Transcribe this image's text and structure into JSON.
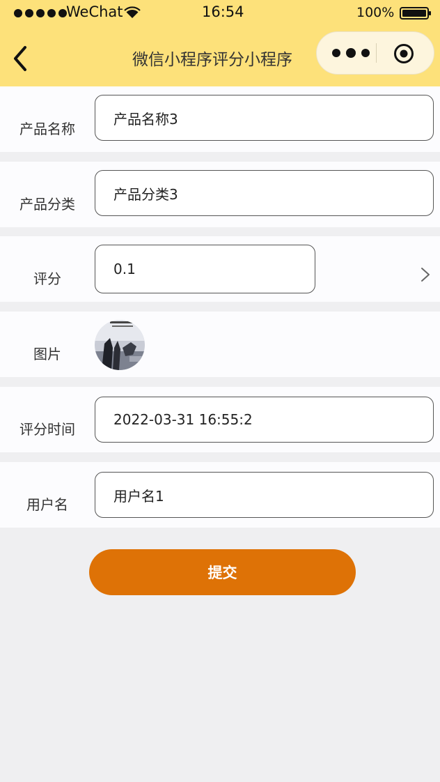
{
  "status_bar": {
    "carrier": "WeChat",
    "time": "16:54",
    "battery": "100%"
  },
  "nav": {
    "title": "微信小程序评分小程序"
  },
  "form": {
    "product_name": {
      "label": "产品名称",
      "value": "产品名称3"
    },
    "product_category": {
      "label": "产品分类",
      "value": "产品分类3"
    },
    "score": {
      "label": "评分",
      "value": "0.1"
    },
    "image": {
      "label": "图片"
    },
    "score_time": {
      "label": "评分时间",
      "value": "2022-03-31 16:55:2"
    },
    "username": {
      "label": "用户名",
      "value": "用户名1"
    }
  },
  "submit_label": "提交",
  "colors": {
    "header_bg": "#fde17a",
    "capsule_bg": "#fdf5dd",
    "page_bg": "#efeff1",
    "submit_bg": "#de7206"
  },
  "icons": [
    "wifi-icon",
    "battery-icon",
    "back-icon",
    "more-icon",
    "close-circle-icon",
    "chevron-right-icon"
  ]
}
